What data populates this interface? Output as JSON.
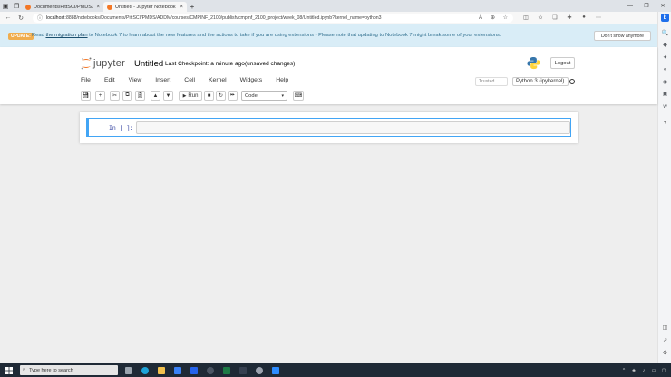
{
  "browser": {
    "tabs": [
      {
        "title": "Documents/PittSCI/PMDS/ADDM/",
        "active": false
      },
      {
        "title": "Untitled - Jupyter Notebook",
        "active": true
      }
    ],
    "url_host": "localhost",
    "url_rest": ":8888/notebooks/Documents/PittSCI/PMDS/ADDM/courses/CMPINF_2100/publish/cmpinf_2100_project/week_08/Untitled.ipynb?kernel_name=python3"
  },
  "banner": {
    "label": "UPDATE:",
    "text_before": "Read ",
    "link": "the migration plan",
    "text_after": " to Notebook 7 to learn about the new features and the actions to take if you are using extensions - Please note that updating to Notebook 7 might break some of your extensions.",
    "dismiss": "Don't show anymore"
  },
  "header": {
    "logo_text": "jupyter",
    "notebook_title": "Untitled",
    "checkpoint": "Last Checkpoint: a minute ago",
    "unsaved": "(unsaved changes)",
    "logout": "Logout"
  },
  "menu": [
    "File",
    "Edit",
    "View",
    "Insert",
    "Cell",
    "Kernel",
    "Widgets",
    "Help"
  ],
  "status": {
    "trusted": "Trusted",
    "kernel": "Python 3 (ipykernel)"
  },
  "toolbar": {
    "run_label": "Run",
    "cell_type": "Code"
  },
  "cell": {
    "prompt": "In [ ]:"
  },
  "taskbar": {
    "search_placeholder": "Type here to search"
  },
  "colors": {
    "banner_bg": "#d9edf7",
    "banner_label": "#f0ad4e",
    "cell_border": "#42a5f5",
    "jupyter_orange": "#f37726",
    "taskbar_bg": "#1f2a36"
  }
}
